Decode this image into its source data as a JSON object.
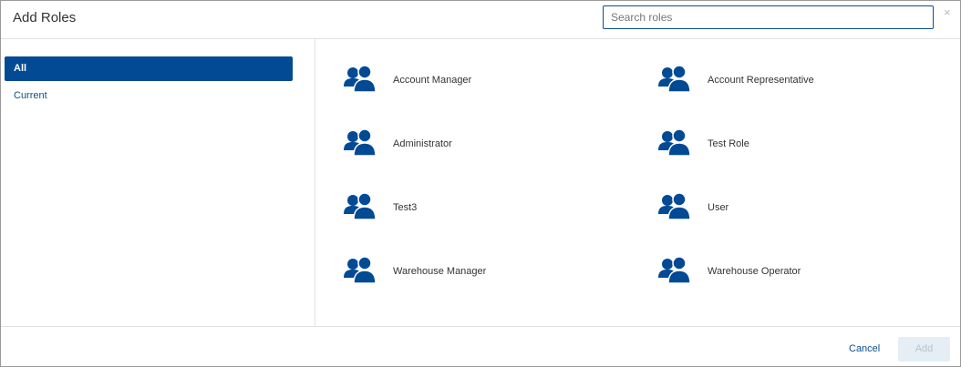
{
  "dialog": {
    "title": "Add Roles",
    "search_placeholder": "Search roles",
    "close_glyph": "×"
  },
  "sidebar": {
    "items": [
      {
        "label": "All",
        "active": true
      },
      {
        "label": "Current",
        "active": false
      }
    ]
  },
  "roles": [
    {
      "name": "Account Manager",
      "icon": "users-icon"
    },
    {
      "name": "Account Representative",
      "icon": "users-icon"
    },
    {
      "name": "Administrator",
      "icon": "users-icon"
    },
    {
      "name": "Test Role",
      "icon": "users-icon"
    },
    {
      "name": "Test3",
      "icon": "users-icon"
    },
    {
      "name": "User",
      "icon": "users-icon"
    },
    {
      "name": "Warehouse Manager",
      "icon": "users-icon"
    },
    {
      "name": "Warehouse Operator",
      "icon": "users-icon"
    }
  ],
  "footer": {
    "cancel_label": "Cancel",
    "add_label": "Add"
  },
  "colors": {
    "accent": "#034a94",
    "link": "#0a4f8f",
    "disabled_bg": "#e6eef5",
    "disabled_text": "#b6c3cf"
  }
}
